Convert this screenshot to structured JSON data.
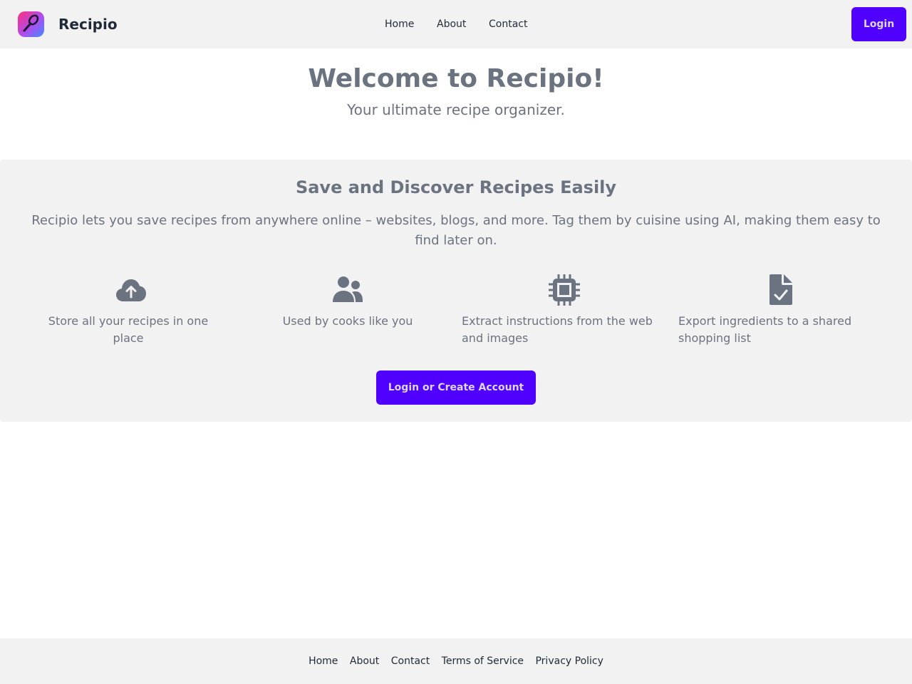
{
  "brand": {
    "name": "Recipio",
    "logo_icon": "whisk-icon"
  },
  "nav": {
    "home": "Home",
    "about": "About",
    "contact": "Contact",
    "login": "Login"
  },
  "hero": {
    "title": "Welcome to Recipio!",
    "subtitle": "Your ultimate recipe organizer."
  },
  "features": {
    "title": "Save and Discover Recipes Easily",
    "description": "Recipio lets you save recipes from anywhere online – websites, blogs, and more. Tag them by cuisine using AI, making them easy to find later on.",
    "items": [
      {
        "icon": "cloud-upload-icon",
        "text": "Store all your recipes in one place"
      },
      {
        "icon": "users-icon",
        "text": "Used by cooks like you"
      },
      {
        "icon": "chip-icon",
        "text": "Extract instructions from the web and images"
      },
      {
        "icon": "file-check-icon",
        "text": "Export ingredients to a shared shopping list"
      }
    ],
    "cta": "Login or Create Account"
  },
  "footer": {
    "home": "Home",
    "about": "About",
    "contact": "Contact",
    "terms": "Terms of Service",
    "privacy": "Privacy Policy"
  },
  "colors": {
    "accent": "#5000ff",
    "accent_text": "#dcd6f7",
    "text_muted": "#6b7280",
    "text_dark": "#1f2937",
    "panel_bg": "#f2f2f2"
  }
}
